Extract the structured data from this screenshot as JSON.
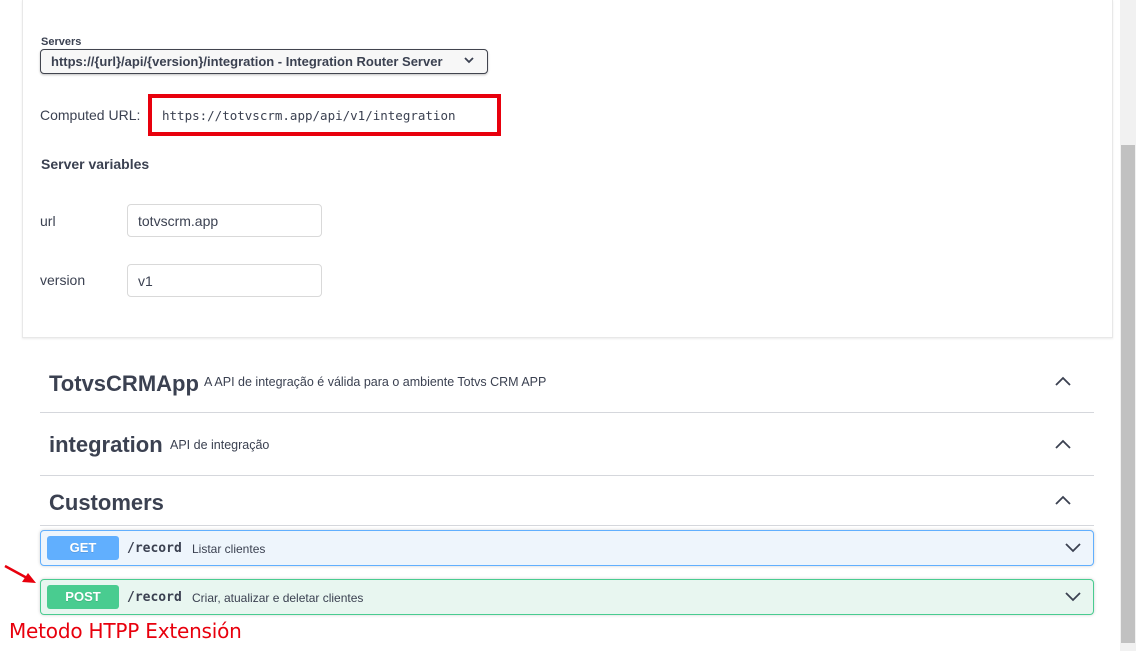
{
  "servers": {
    "label": "Servers",
    "selected": "https://{url}/api/{version}/integration - Integration Router Server",
    "computed_label": "Computed URL:",
    "computed_url": "https://totvscrm.app/api/v1/integration",
    "variables_title": "Server variables",
    "variables": [
      {
        "name": "url",
        "value": "totvscrm.app"
      },
      {
        "name": "version",
        "value": "v1"
      }
    ]
  },
  "tags": [
    {
      "name": "TotvsCRMApp",
      "description": "A API de integração é válida para o ambiente Totvs CRM APP"
    },
    {
      "name": "integration",
      "description": "API de integração"
    },
    {
      "name": "Customers",
      "description": ""
    }
  ],
  "operations": [
    {
      "method": "GET",
      "path": "/record",
      "summary": "Listar clientes",
      "color": "#61affe"
    },
    {
      "method": "POST",
      "path": "/record",
      "summary": "Criar, atualizar e deletar clientes",
      "color": "#49cc90"
    }
  ],
  "annotation": {
    "text": "Metodo HTPP Extensión",
    "color": "#e8000d"
  },
  "icons": {
    "select": "chevron-down-icon",
    "tag_toggle": "chevron-up-icon",
    "op_toggle": "chevron-down-icon",
    "annotation_pointer": "red-arrow-icon"
  }
}
